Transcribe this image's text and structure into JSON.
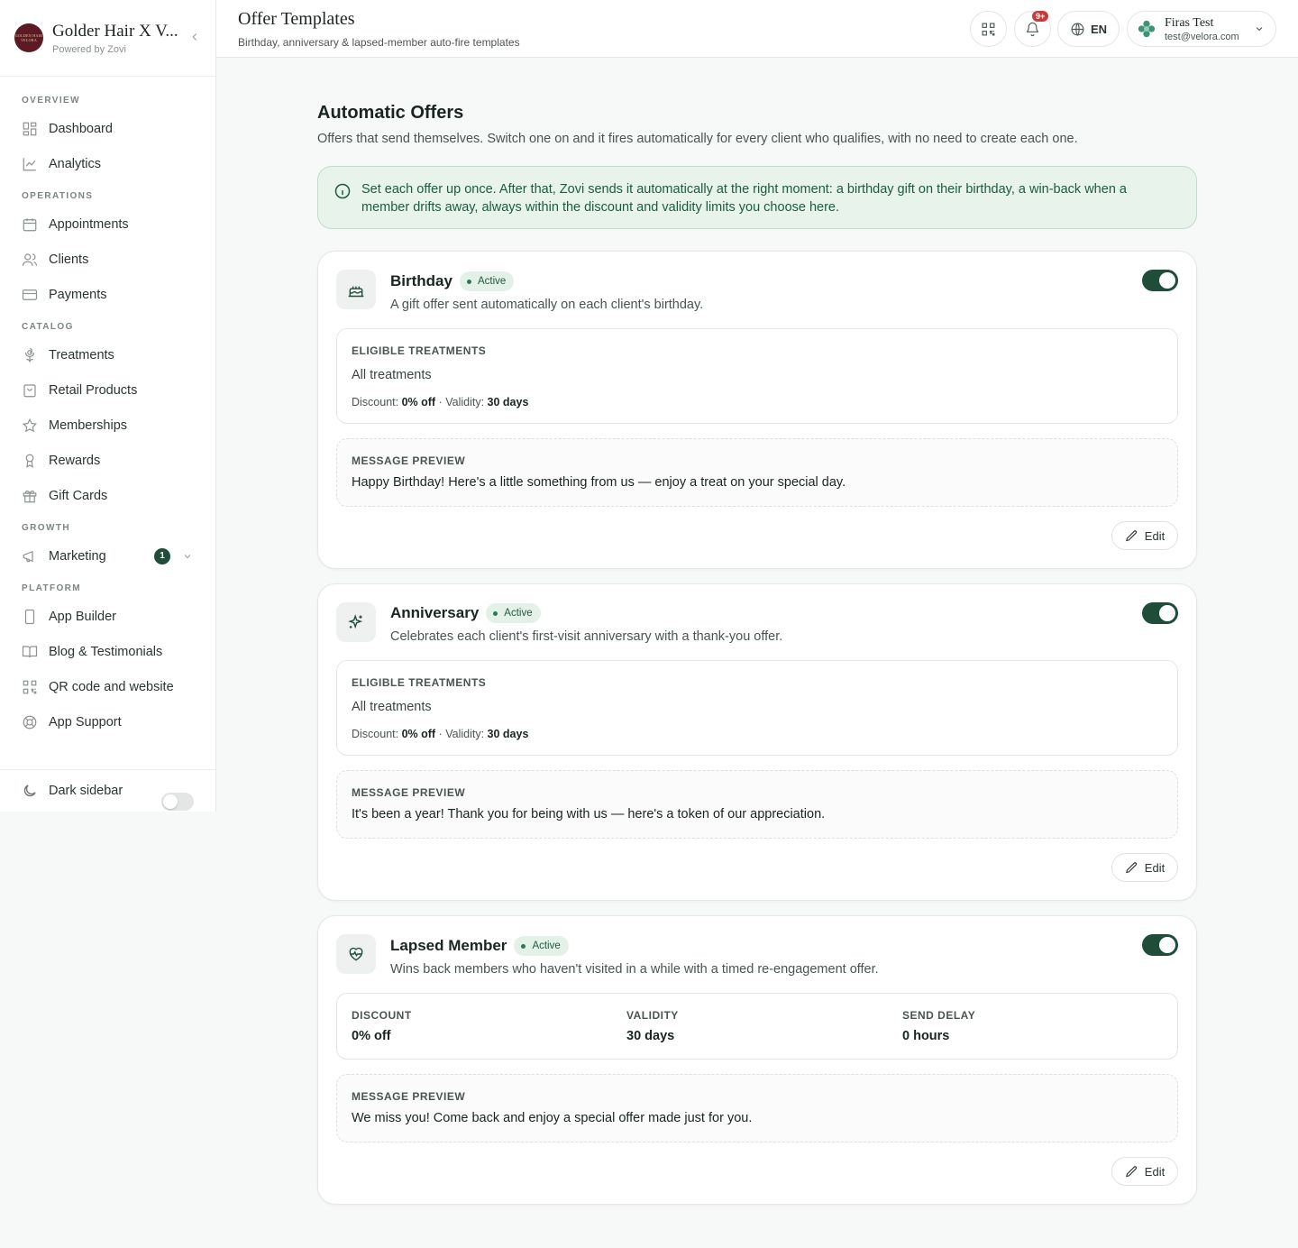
{
  "brand": {
    "logo_text": "GOLDEN HAIR VELORA",
    "name": "Golder Hair X V...",
    "sub": "Powered by Zovi"
  },
  "sidebar": {
    "sections": [
      {
        "title": "OVERVIEW",
        "items": [
          {
            "label": "Dashboard",
            "icon": "grid-icon"
          },
          {
            "label": "Analytics",
            "icon": "chart-line-icon"
          }
        ]
      },
      {
        "title": "OPERATIONS",
        "items": [
          {
            "label": "Appointments",
            "icon": "calendar-icon"
          },
          {
            "label": "Clients",
            "icon": "users-icon"
          },
          {
            "label": "Payments",
            "icon": "credit-card-icon"
          }
        ]
      },
      {
        "title": "CATALOG",
        "items": [
          {
            "label": "Treatments",
            "icon": "flower-icon"
          },
          {
            "label": "Retail Products",
            "icon": "shopping-bag-icon"
          },
          {
            "label": "Memberships",
            "icon": "star-icon"
          },
          {
            "label": "Rewards",
            "icon": "award-icon"
          },
          {
            "label": "Gift Cards",
            "icon": "gift-icon"
          }
        ]
      },
      {
        "title": "GROWTH",
        "items": [
          {
            "label": "Marketing",
            "icon": "megaphone-icon",
            "badge": "1"
          }
        ]
      },
      {
        "title": "PLATFORM",
        "items": [
          {
            "label": "App Builder",
            "icon": "smartphone-icon"
          },
          {
            "label": "Blog & Testimonials",
            "icon": "book-open-icon"
          },
          {
            "label": "QR code and website",
            "icon": "qr-code-icon"
          },
          {
            "label": "App Support",
            "icon": "life-buoy-icon"
          }
        ]
      }
    ],
    "footer_label": "Dark sidebar"
  },
  "topbar": {
    "title": "Offer Templates",
    "subtitle": "Birthday, anniversary & lapsed-member auto-fire templates",
    "notif_count": "9+",
    "lang": "EN",
    "user_name": "Firas Test",
    "user_email": "test@velora.com"
  },
  "main": {
    "heading": "Automatic Offers",
    "subheading": "Offers that send themselves. Switch one on and it fires automatically for every client who qualifies, with no need to create each one.",
    "info": "Set each offer up once. After that, Zovi sends it automatically at the right moment: a birthday gift on their birthday, a win-back when a member drifts away, always within the discount and validity limits you choose here.",
    "common": {
      "eligible_label": "ELIGIBLE TREATMENTS",
      "message_label": "MESSAGE PREVIEW",
      "discount_prefix": "Discount:",
      "validity_prefix": "· Validity:",
      "edit_label": "Edit",
      "status": "Active"
    },
    "cards": [
      {
        "title": "Birthday",
        "desc": "A gift offer sent automatically on each client's birthday.",
        "eligible": "All treatments",
        "discount": "0% off",
        "validity": "30 days",
        "message": "Happy Birthday! Here's a little something from us — enjoy a treat on your special day."
      },
      {
        "title": "Anniversary",
        "desc": "Celebrates each client's first-visit anniversary with a thank-you offer.",
        "eligible": "All treatments",
        "discount": "0% off",
        "validity": "30 days",
        "message": "It's been a year! Thank you for being with us — here's a token of our appreciation."
      },
      {
        "title": "Lapsed Member",
        "desc": "Wins back members who haven't visited in a while with a timed re-engagement offer.",
        "discount_label": "DISCOUNT",
        "discount": "0% off",
        "validity_label": "VALIDITY",
        "validity": "30 days",
        "delay_label": "SEND DELAY",
        "delay": "0 hours",
        "message": "We miss you! Come back and enjoy a special offer made just for you."
      }
    ]
  }
}
